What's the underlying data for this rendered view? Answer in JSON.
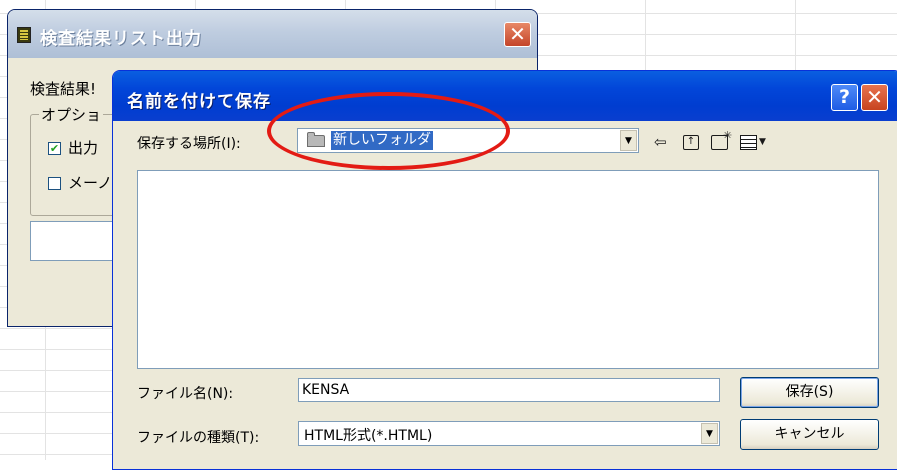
{
  "back_window": {
    "title": "検査結果リスト出力",
    "label_partial": "検査結果!",
    "group_title_partial": "オプショ",
    "option1_partial": "出力",
    "option1_checked": true,
    "option2_partial": "メーノ",
    "option2_checked": false
  },
  "dialog": {
    "title": "名前を付けて保存",
    "help_glyph": "?",
    "close_glyph": "✕",
    "save_in_label": "保存する場所(I):",
    "save_in_value": "新しいフォルダ",
    "filename_label": "ファイル名(N):",
    "filename_value": "KENSA",
    "filetype_label": "ファイルの種類(T):",
    "filetype_value": "HTML形式(*.HTML)",
    "save_button": "保存(S)",
    "cancel_button": "キャンセル"
  },
  "icons": {
    "back": "back-arrow-icon",
    "up": "up-folder-icon",
    "new_folder": "new-folder-icon",
    "view_menu": "view-menu-icon"
  },
  "colors": {
    "dialog_title_bar": "#0246d9",
    "selection": "#316ac5",
    "highlight_ellipse": "#e31b14",
    "dialog_face": "#ece9d8"
  }
}
